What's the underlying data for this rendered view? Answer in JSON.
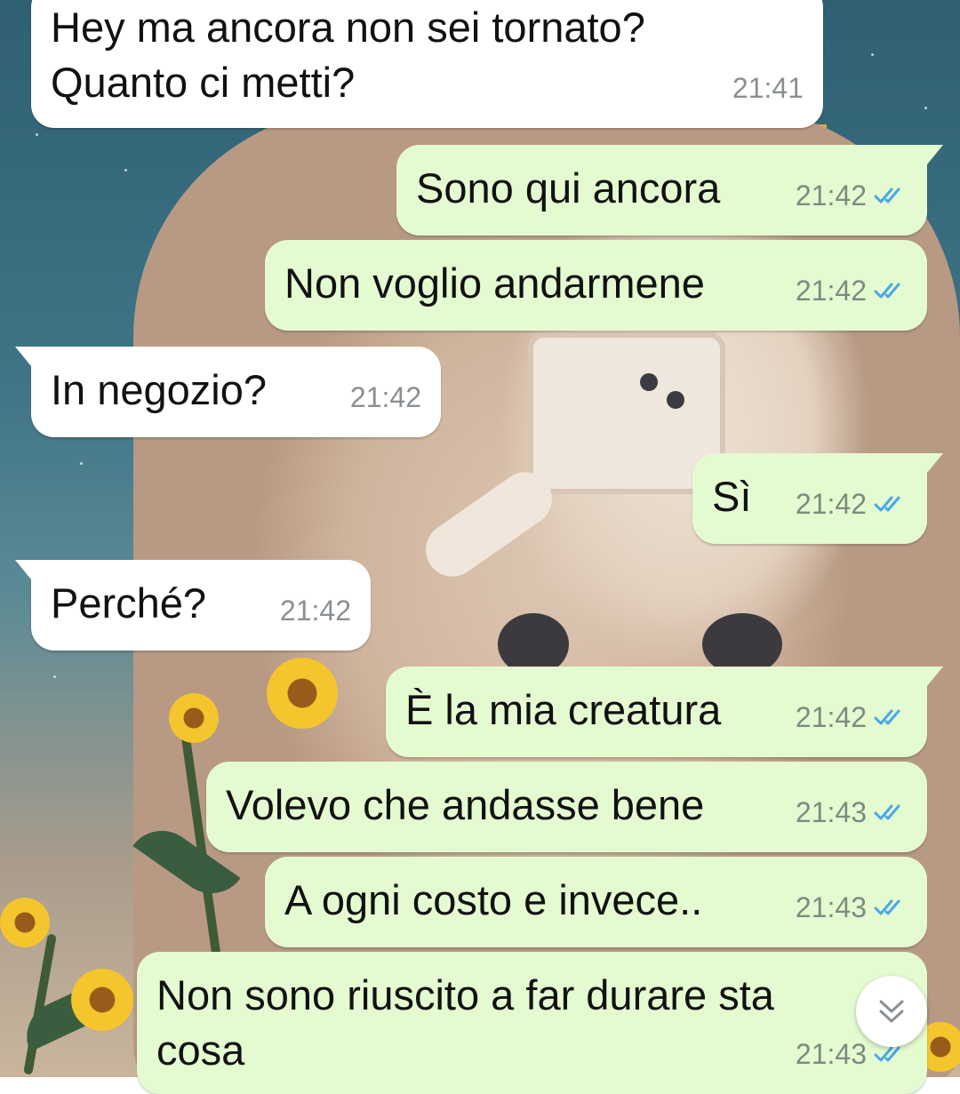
{
  "colors": {
    "incoming_bubble": "#ffffff",
    "outgoing_bubble": "#e4fbd1",
    "read_ticks": "#4aa7e6",
    "time_text": "#7d8b7f"
  },
  "messages": [
    {
      "direction": "in",
      "lines": [
        "Hey ma ancora non sei tornato?",
        "Quanto ci metti?"
      ],
      "time": "21:41"
    },
    {
      "direction": "out",
      "lines": [
        "Sono qui ancora"
      ],
      "time": "21:42",
      "status": "read"
    },
    {
      "direction": "out",
      "lines": [
        "Non voglio andarmene"
      ],
      "time": "21:42",
      "status": "read"
    },
    {
      "direction": "in",
      "lines": [
        "In negozio?"
      ],
      "time": "21:42"
    },
    {
      "direction": "out",
      "lines": [
        "Sì"
      ],
      "time": "21:42",
      "status": "read"
    },
    {
      "direction": "in",
      "lines": [
        "Perché?"
      ],
      "time": "21:42"
    },
    {
      "direction": "out",
      "lines": [
        "È la mia creatura"
      ],
      "time": "21:42",
      "status": "read"
    },
    {
      "direction": "out",
      "lines": [
        "Volevo che andasse bene"
      ],
      "time": "21:43",
      "status": "read"
    },
    {
      "direction": "out",
      "lines": [
        "A ogni costo e invece.."
      ],
      "time": "21:43",
      "status": "read"
    },
    {
      "direction": "out",
      "lines": [
        "Non sono riuscito a far durare sta",
        "cosa"
      ],
      "time": "21:43",
      "status": "read"
    }
  ],
  "scroll_button": {
    "icon": "double-chevron-down-icon"
  }
}
